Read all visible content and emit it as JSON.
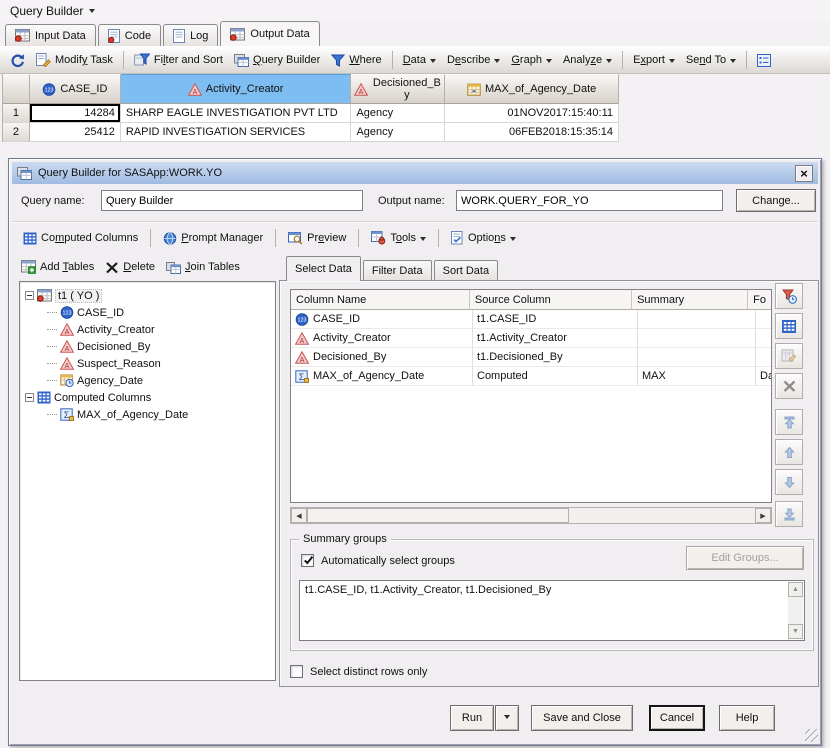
{
  "colors": {
    "selected_column_header": "#7ebdf2",
    "dialog_titlebar_top": "#ccdbf2",
    "dialog_titlebar_bottom": "#9fbbe1",
    "char_column_icon": "#cc5555",
    "numeric_column_icon": "#2f63c8"
  },
  "app": {
    "title": "Query Builder",
    "tabs": [
      {
        "label": "Input Data"
      },
      {
        "label": "Code"
      },
      {
        "label": "Log"
      },
      {
        "label": "Output Data"
      }
    ],
    "toolbar": {
      "modify_task": "Modif<u>y</u> Task",
      "filter_and_sort": "Fi<u>l</u>ter and Sort",
      "query_builder": "<u>Q</u>uery Builder",
      "where": "<u>W</u>here",
      "data": "<u>D</u>ata",
      "describe": "D<u>e</u>scribe",
      "graph": "<u>G</u>raph",
      "analyze": "Analy<u>z</u>e",
      "export": "E<u>x</u>port",
      "send_to": "Se<u>n</u>d To"
    }
  },
  "grid": {
    "headers": [
      "CASE_ID",
      "Activity_Creator",
      "Decisioned_By",
      "MAX_of_Agency_Date"
    ],
    "rows": [
      {
        "num": "1",
        "case_id": "14284",
        "activity_creator": "SHARP EAGLE INVESTIGATION PVT LTD",
        "decisioned_by": "Agency",
        "max_of_agency_date": "01NOV2017:15:40:11"
      },
      {
        "num": "2",
        "case_id": "25412",
        "activity_creator": "RAPID INVESTIGATION SERVICES",
        "decisioned_by": "Agency",
        "max_of_agency_date": "06FEB2018:15:35:14"
      }
    ]
  },
  "dialog": {
    "title": "Query Builder for SASApp:WORK.YO",
    "query_name_label": "Query name:",
    "query_name_value": "Query Builder",
    "output_name_label": "Output name:",
    "output_name_value": "WORK.QUERY_FOR_YO",
    "change_button": "Change...",
    "toolbar": {
      "computed_columns": "Co<u>m</u>puted Columns",
      "prompt_manager": "<u>P</u>rompt Manager",
      "preview": "Pr<u>e</u>view",
      "tools": "T<u>o</u>ols",
      "options": "Optio<u>n</u>s"
    },
    "tree_toolbar": {
      "add_tables": "Add <u>T</u>ables",
      "delete": "<u>D</u>elete",
      "join_tables": "<u>J</u>oin Tables"
    },
    "tree": {
      "root": "t1 ( YO )",
      "columns": [
        "CASE_ID",
        "Activity_Creator",
        "Decisioned_By",
        "Suspect_Reason",
        "Agency_Date"
      ],
      "computed_root": "Computed Columns",
      "computed_columns": [
        "MAX_of_Agency_Date"
      ]
    },
    "tabs": [
      "Select Data",
      "Filter Data",
      "Sort Data"
    ],
    "select_table": {
      "headers": [
        "Column Name",
        "Source Column",
        "Summary",
        "Fo"
      ],
      "rows": [
        {
          "name": "CASE_ID",
          "source": "t1.CASE_ID",
          "summary": "",
          "format": ""
        },
        {
          "name": "Activity_Creator",
          "source": "t1.Activity_Creator",
          "summary": "",
          "format": ""
        },
        {
          "name": "Decisioned_By",
          "source": "t1.Decisioned_By",
          "summary": "",
          "format": ""
        },
        {
          "name": "MAX_of_Agency_Date",
          "source": "Computed",
          "summary": "MAX",
          "format": "Da"
        }
      ]
    },
    "summary_groups": {
      "legend": "Summary groups",
      "auto_select_label": "Automatically select groups",
      "auto_select_checked": true,
      "edit_groups_button": "Edit Groups...",
      "groups_value": "t1.CASE_ID, t1.Activity_Creator, t1.Decisioned_By"
    },
    "distinct_label": "Select distinct rows only",
    "distinct_checked": false,
    "buttons": {
      "run": "Run",
      "save_and_close": "Save and Close",
      "cancel": "Cancel",
      "help": "Help"
    }
  }
}
